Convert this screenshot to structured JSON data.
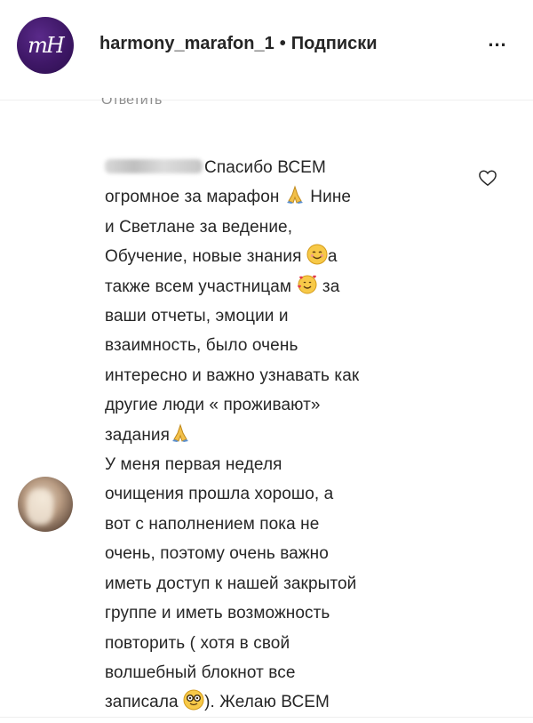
{
  "header": {
    "logo_text": "mH",
    "username": "harmony_marafon_1",
    "separator": "•",
    "follow_label": "Подписки",
    "more_label": "..."
  },
  "reply_label": "Ответить",
  "comment": {
    "author_hidden": true,
    "lines": [
      "Спасибо ВСЕМ",
      "огромное за марафон",
      "Нине",
      "и Светлане за ведение,",
      "Обучение, новые знания",
      "а",
      "также всем участницам",
      "за",
      "ваши отчеты, эмоции и",
      "взаимность, было очень",
      "интересно и важно узнавать как",
      "другие люди « проживают»",
      "задания",
      "У меня первая неделя",
      "очищения прошла хорошо, а",
      "вот с наполнением пока не",
      "очень, поэтому очень важно",
      "иметь доступ к нашей закрытой",
      "группе и иметь возможность",
      "повторить ( хотя в свой",
      "волшебный блокнот все",
      "записала",
      "). Желаю ВСЕМ"
    ]
  },
  "icons": {
    "heart": "heart-icon",
    "pray": "praying-hands-emoji",
    "smile": "smiling-face-emoji",
    "hearts_smile": "smiling-face-with-hearts-emoji",
    "glasses": "face-with-glasses-emoji"
  },
  "colors": {
    "text": "#262626",
    "muted": "#8e8e8e",
    "logo_bg": "#3e1766",
    "divider": "#efefef"
  }
}
